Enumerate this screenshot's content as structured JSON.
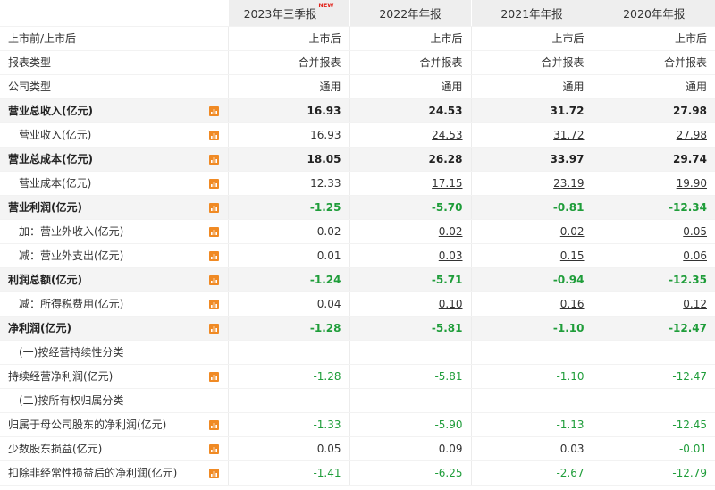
{
  "colors": {
    "negative": "#1f9d3a",
    "new_badge": "#e2231a",
    "header_bg": "#eeeeee",
    "bold_row_bg": "#f4f4f4",
    "icon": "#f08a24"
  },
  "new_badge": "NEW",
  "columns": [
    "2023年三季报",
    "2022年年报",
    "2021年年报",
    "2020年年报"
  ],
  "rows": [
    {
      "label": "上市前/上市后",
      "kind": "plain",
      "icon": false,
      "values": [
        "上市后",
        "上市后",
        "上市后",
        "上市后"
      ],
      "green": false,
      "link": false
    },
    {
      "label": "报表类型",
      "kind": "plain",
      "icon": false,
      "values": [
        "合并报表",
        "合并报表",
        "合并报表",
        "合并报表"
      ],
      "green": false,
      "link": false
    },
    {
      "label": "公司类型",
      "kind": "plain",
      "icon": false,
      "values": [
        "通用",
        "通用",
        "通用",
        "通用"
      ],
      "green": false,
      "link": false
    },
    {
      "label": "营业总收入(亿元)",
      "kind": "bold",
      "icon": true,
      "values": [
        "16.93",
        "24.53",
        "31.72",
        "27.98"
      ],
      "green": false,
      "link": false
    },
    {
      "label": "营业收入(亿元)",
      "kind": "sub",
      "icon": true,
      "values": [
        "16.93",
        "24.53",
        "31.72",
        "27.98"
      ],
      "green": false,
      "link": true
    },
    {
      "label": "营业总成本(亿元)",
      "kind": "bold",
      "icon": true,
      "values": [
        "18.05",
        "26.28",
        "33.97",
        "29.74"
      ],
      "green": false,
      "link": false
    },
    {
      "label": "营业成本(亿元)",
      "kind": "sub",
      "icon": true,
      "values": [
        "12.33",
        "17.15",
        "23.19",
        "19.90"
      ],
      "green": false,
      "link": true
    },
    {
      "label": "营业利润(亿元)",
      "kind": "bold",
      "icon": true,
      "values": [
        "-1.25",
        "-5.70",
        "-0.81",
        "-12.34"
      ],
      "green": true,
      "link": false
    },
    {
      "label": "加：营业外收入(亿元)",
      "kind": "sub",
      "icon": true,
      "values": [
        "0.02",
        "0.02",
        "0.02",
        "0.05"
      ],
      "green": false,
      "link": true
    },
    {
      "label": "减：营业外支出(亿元)",
      "kind": "sub",
      "icon": true,
      "values": [
        "0.01",
        "0.03",
        "0.15",
        "0.06"
      ],
      "green": false,
      "link": true
    },
    {
      "label": "利润总额(亿元)",
      "kind": "bold",
      "icon": true,
      "values": [
        "-1.24",
        "-5.71",
        "-0.94",
        "-12.35"
      ],
      "green": true,
      "link": false
    },
    {
      "label": "减：所得税费用(亿元)",
      "kind": "sub",
      "icon": true,
      "values": [
        "0.04",
        "0.10",
        "0.16",
        "0.12"
      ],
      "green": false,
      "link": true
    },
    {
      "label": "净利润(亿元)",
      "kind": "bold",
      "icon": true,
      "values": [
        "-1.28",
        "-5.81",
        "-1.10",
        "-12.47"
      ],
      "green": true,
      "link": false
    },
    {
      "label": "(一)按经营持续性分类",
      "kind": "sub",
      "icon": false,
      "values": [
        "",
        "",
        "",
        ""
      ],
      "green": false,
      "link": false
    },
    {
      "label": "持续经营净利润(亿元)",
      "kind": "plain",
      "icon": true,
      "values": [
        "-1.28",
        "-5.81",
        "-1.10",
        "-12.47"
      ],
      "green": true,
      "link": false
    },
    {
      "label": "(二)按所有权归属分类",
      "kind": "sub",
      "icon": false,
      "values": [
        "",
        "",
        "",
        ""
      ],
      "green": false,
      "link": false
    },
    {
      "label": "归属于母公司股东的净利润(亿元)",
      "kind": "plain",
      "icon": true,
      "values": [
        "-1.33",
        "-5.90",
        "-1.13",
        "-12.45"
      ],
      "green": true,
      "link": false
    },
    {
      "label": "少数股东损益(亿元)",
      "kind": "plain",
      "icon": true,
      "values": [
        "0.05",
        "0.09",
        "0.03",
        "-0.01"
      ],
      "green": "mixed",
      "link": false
    },
    {
      "label": "扣除非经常性损益后的净利润(亿元)",
      "kind": "plain",
      "icon": true,
      "values": [
        "-1.41",
        "-6.25",
        "-2.67",
        "-12.79"
      ],
      "green": true,
      "link": false
    }
  ]
}
